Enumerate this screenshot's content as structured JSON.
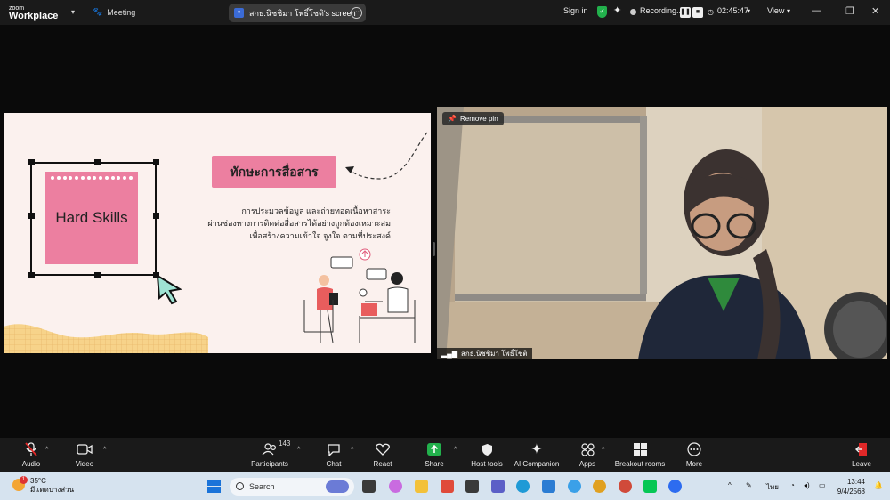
{
  "window": {
    "brand_line1": "zoom",
    "brand_line2": "Workplace",
    "meeting_label": "Meeting",
    "screen_share_label": "สกธ.นิชชิมา โพธิ์โชติ's screen",
    "sign_in": "Sign in",
    "recording_label": "Recording...",
    "timer": "02:45:47",
    "view_label": "View"
  },
  "slide": {
    "hard_skills": "Hard Skills",
    "title": "ทักษะการสื่อสาร",
    "body_line1": "การประมวลข้อมูล และถ่ายทอดเนื้อหาสาระ",
    "body_line2": "ผ่านช่องทางการติดต่อสื่อสารได้อย่างถูกต้องเหมาะสม",
    "body_line3": "เพื่อสร้างความเข้าใจ จูงใจ ตามที่ประสงค์"
  },
  "video": {
    "remove_pin": "Remove pin",
    "participant_name": "สกธ.นิชชิมา โพธิ์โชติ"
  },
  "toolbar": {
    "audio": "Audio",
    "video": "Video",
    "participants": "Participants",
    "participants_count": "143",
    "chat": "Chat",
    "react": "React",
    "share": "Share",
    "host_tools": "Host tools",
    "ai_companion": "AI Companion",
    "apps": "Apps",
    "breakout_rooms": "Breakout rooms",
    "more": "More",
    "leave": "Leave"
  },
  "taskbar": {
    "weather_temp": "35°C",
    "weather_desc": "มีแดดบางส่วน",
    "weather_badge": "1",
    "search_placeholder": "Search",
    "language": "ไทย",
    "time": "13:44",
    "date": "9/4/2568"
  },
  "colors": {
    "accent_pink": "#ec7fa0",
    "share_green": "#22b14c",
    "leave_red": "#e02828"
  }
}
